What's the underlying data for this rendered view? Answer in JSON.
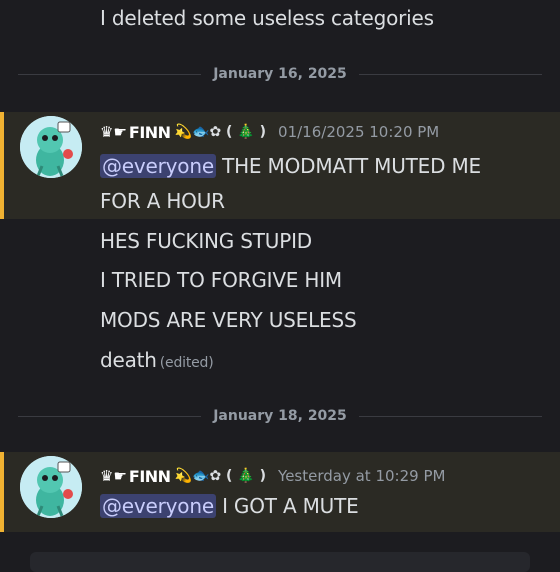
{
  "top_message": "I deleted some useless categories",
  "dividers": [
    "January 16, 2025",
    "January 18, 2025"
  ],
  "message_groups": [
    {
      "username": "FINN",
      "username_prefix": "♛☛",
      "username_suffix": "💫🐟✿ ( 🎄 )",
      "timestamp": "01/16/2025 10:20 PM",
      "mention": "@everyone",
      "first_line_rest": " THE MODMATT MUTED ME",
      "lines": [
        "FOR A HOUR",
        "HES FUCKING STUPID",
        "I TRIED TO FORGIVE HIM",
        "MODS ARE VERY USELESS",
        "death"
      ],
      "edited_label": "(edited)"
    },
    {
      "username": "FINN",
      "username_prefix": "♛☛",
      "username_suffix": "💫🐟✿ ( 🎄 )",
      "timestamp": "Yesterday at 10:29 PM",
      "mention": "@everyone",
      "first_line_rest": " I GOT A MUTE"
    }
  ],
  "colors": {
    "background": "#1c1c20",
    "highlight": "#2b2a24",
    "highlight_bar": "#f0b232",
    "mention_bg": "#3c4270",
    "mention_text": "#c9cdfb"
  },
  "icons": {
    "avatar": "cartoon-character-avatar"
  }
}
